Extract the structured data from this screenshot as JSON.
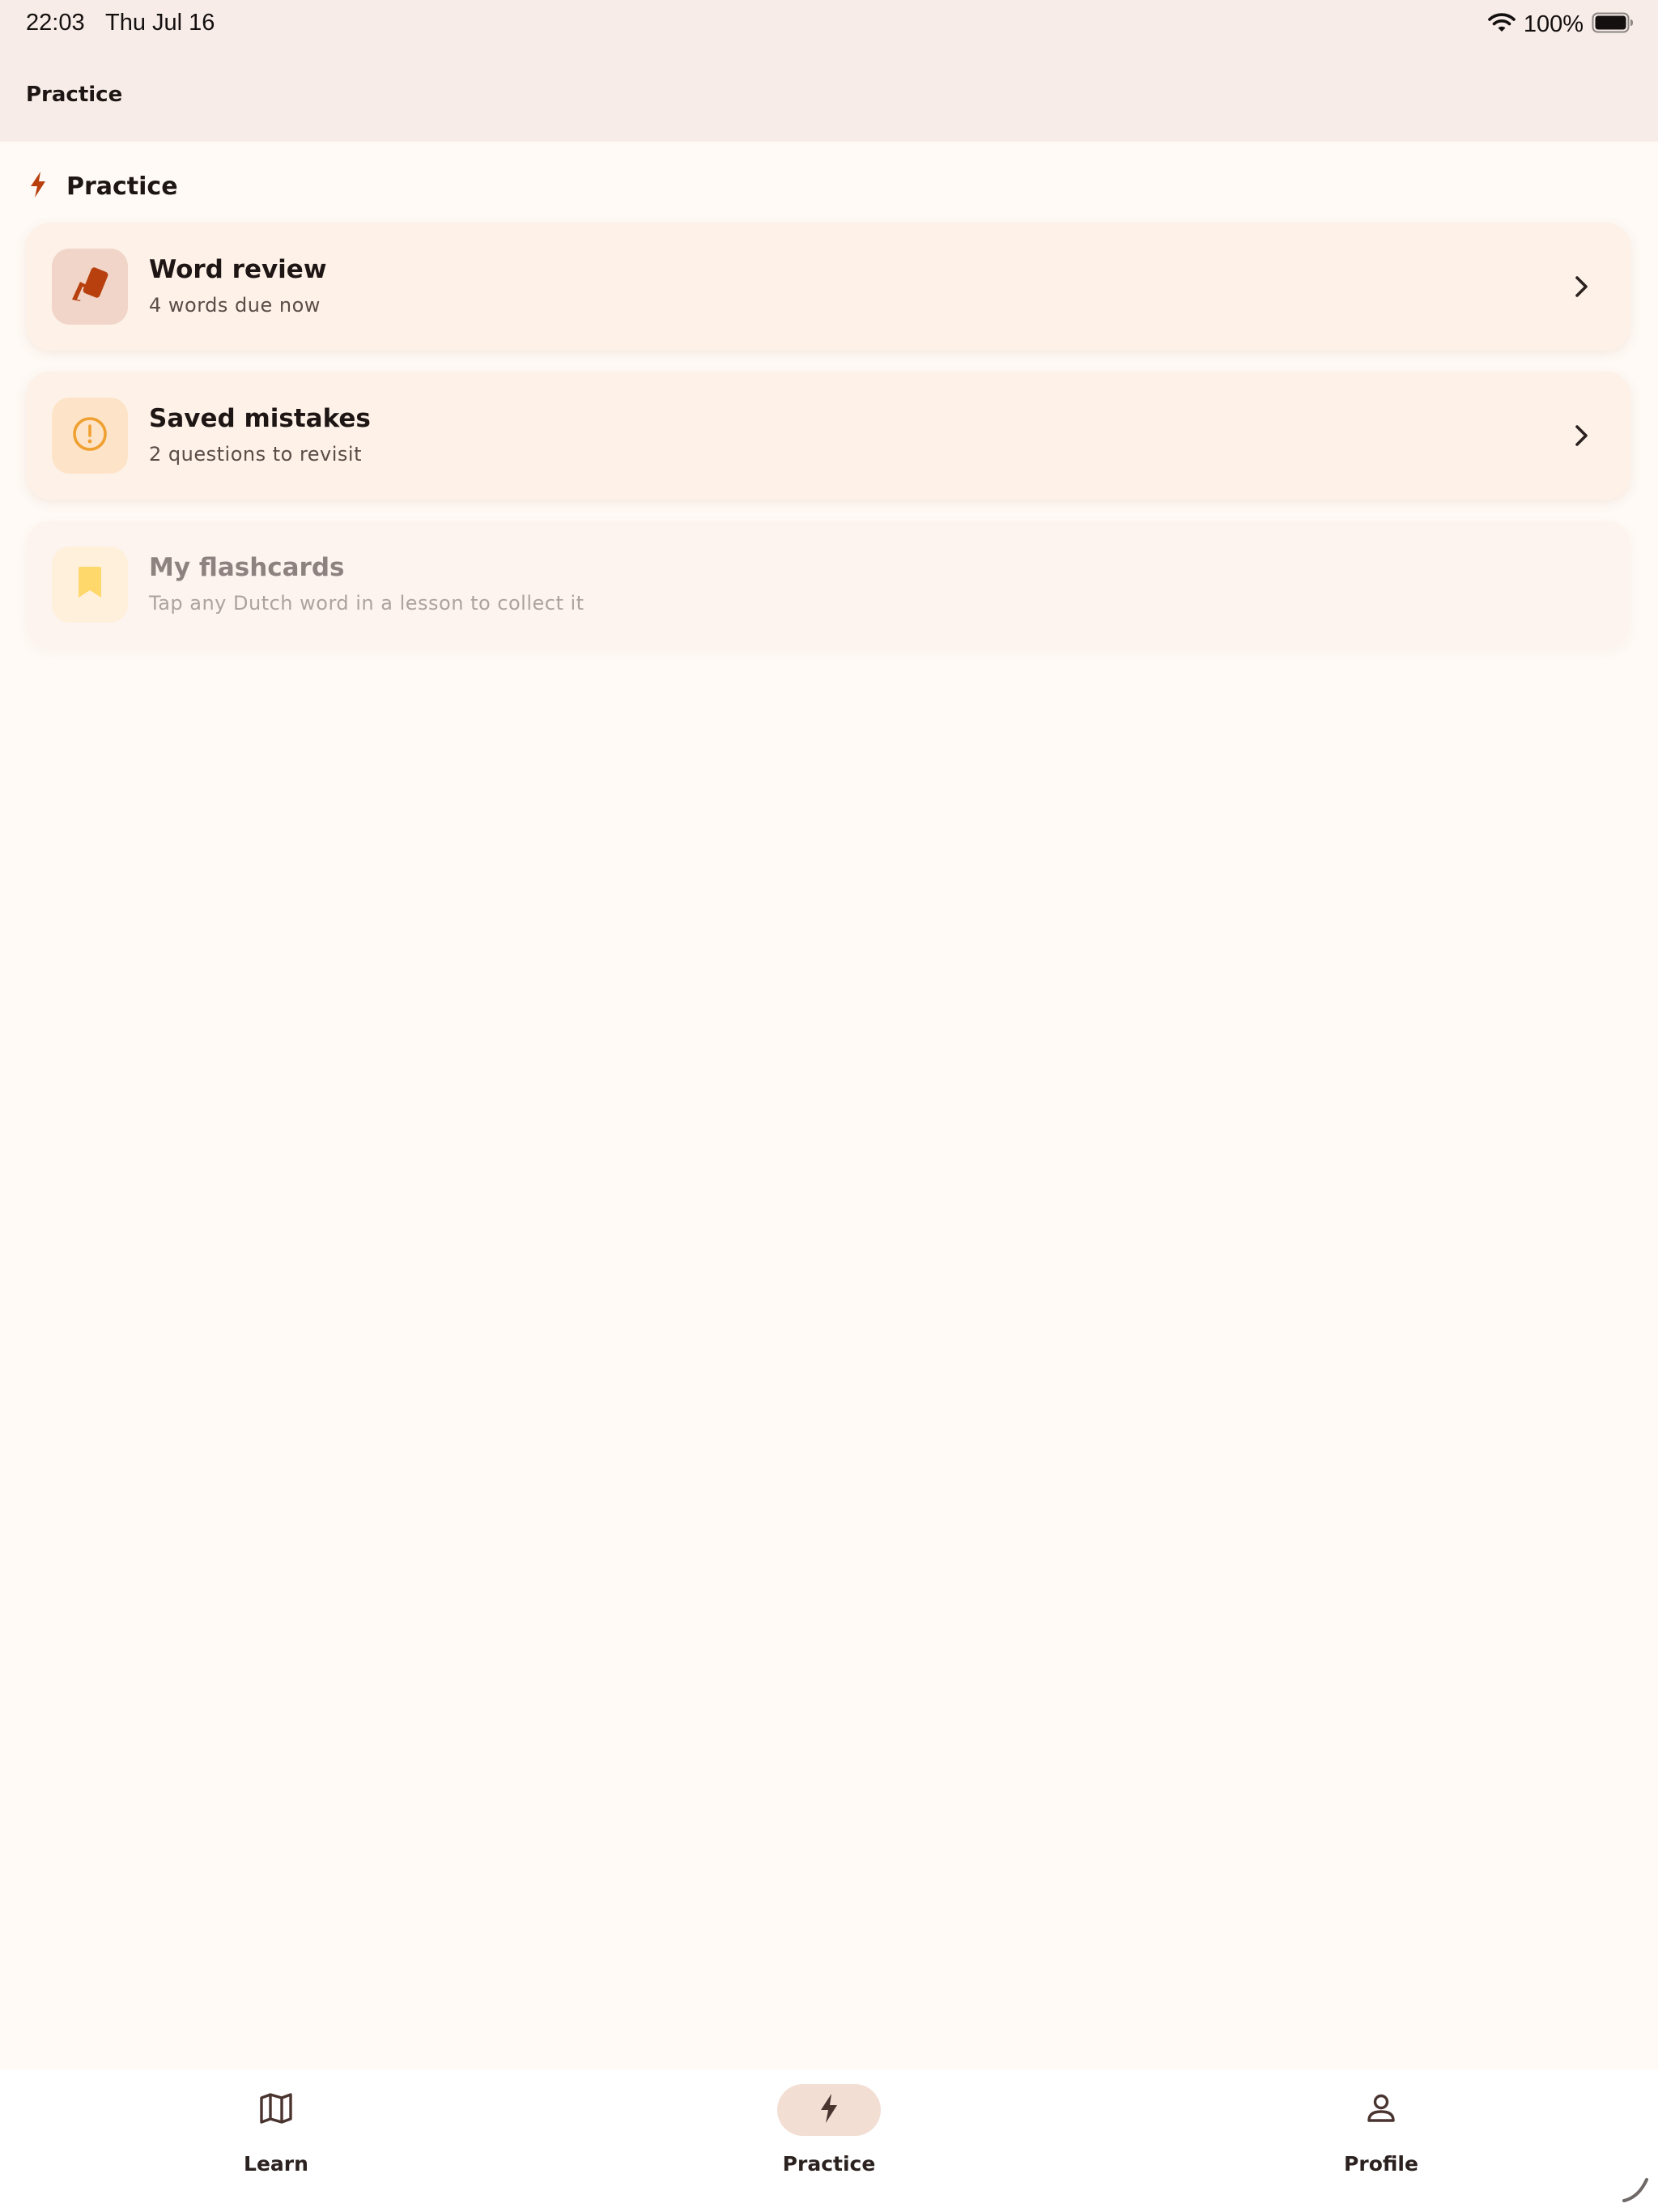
{
  "status_bar": {
    "time": "22:03",
    "date": "Thu Jul 16",
    "battery": "100%",
    "wifi_icon": "wifi-icon",
    "battery_icon": "battery-icon"
  },
  "header": {
    "title": "Practice"
  },
  "section": {
    "icon": "lightning-icon",
    "title": "Practice"
  },
  "cards": [
    {
      "title": "Word review",
      "subtitle": "4 words due now",
      "icon": "cards-icon",
      "enabled": true
    },
    {
      "title": "Saved mistakes",
      "subtitle": "2 questions to revisit",
      "icon": "alert-circle-icon",
      "enabled": true
    },
    {
      "title": "My flashcards",
      "subtitle": "Tap any Dutch word in a lesson to collect it",
      "icon": "bookmark-icon",
      "enabled": false
    }
  ],
  "tabs": [
    {
      "label": "Learn",
      "icon": "map-icon",
      "active": false
    },
    {
      "label": "Practice",
      "icon": "lightning-icon",
      "active": true
    },
    {
      "label": "Profile",
      "icon": "person-icon",
      "active": false
    }
  ],
  "colors": {
    "background": "#FFFAF6",
    "header_bg": "#F7ECE7",
    "card_bg": "#FDF1E8",
    "accent": "#B8400E",
    "warning": "#F0A030",
    "bookmark": "#FFD86B",
    "active_tab_pill": "#F3DED4"
  }
}
